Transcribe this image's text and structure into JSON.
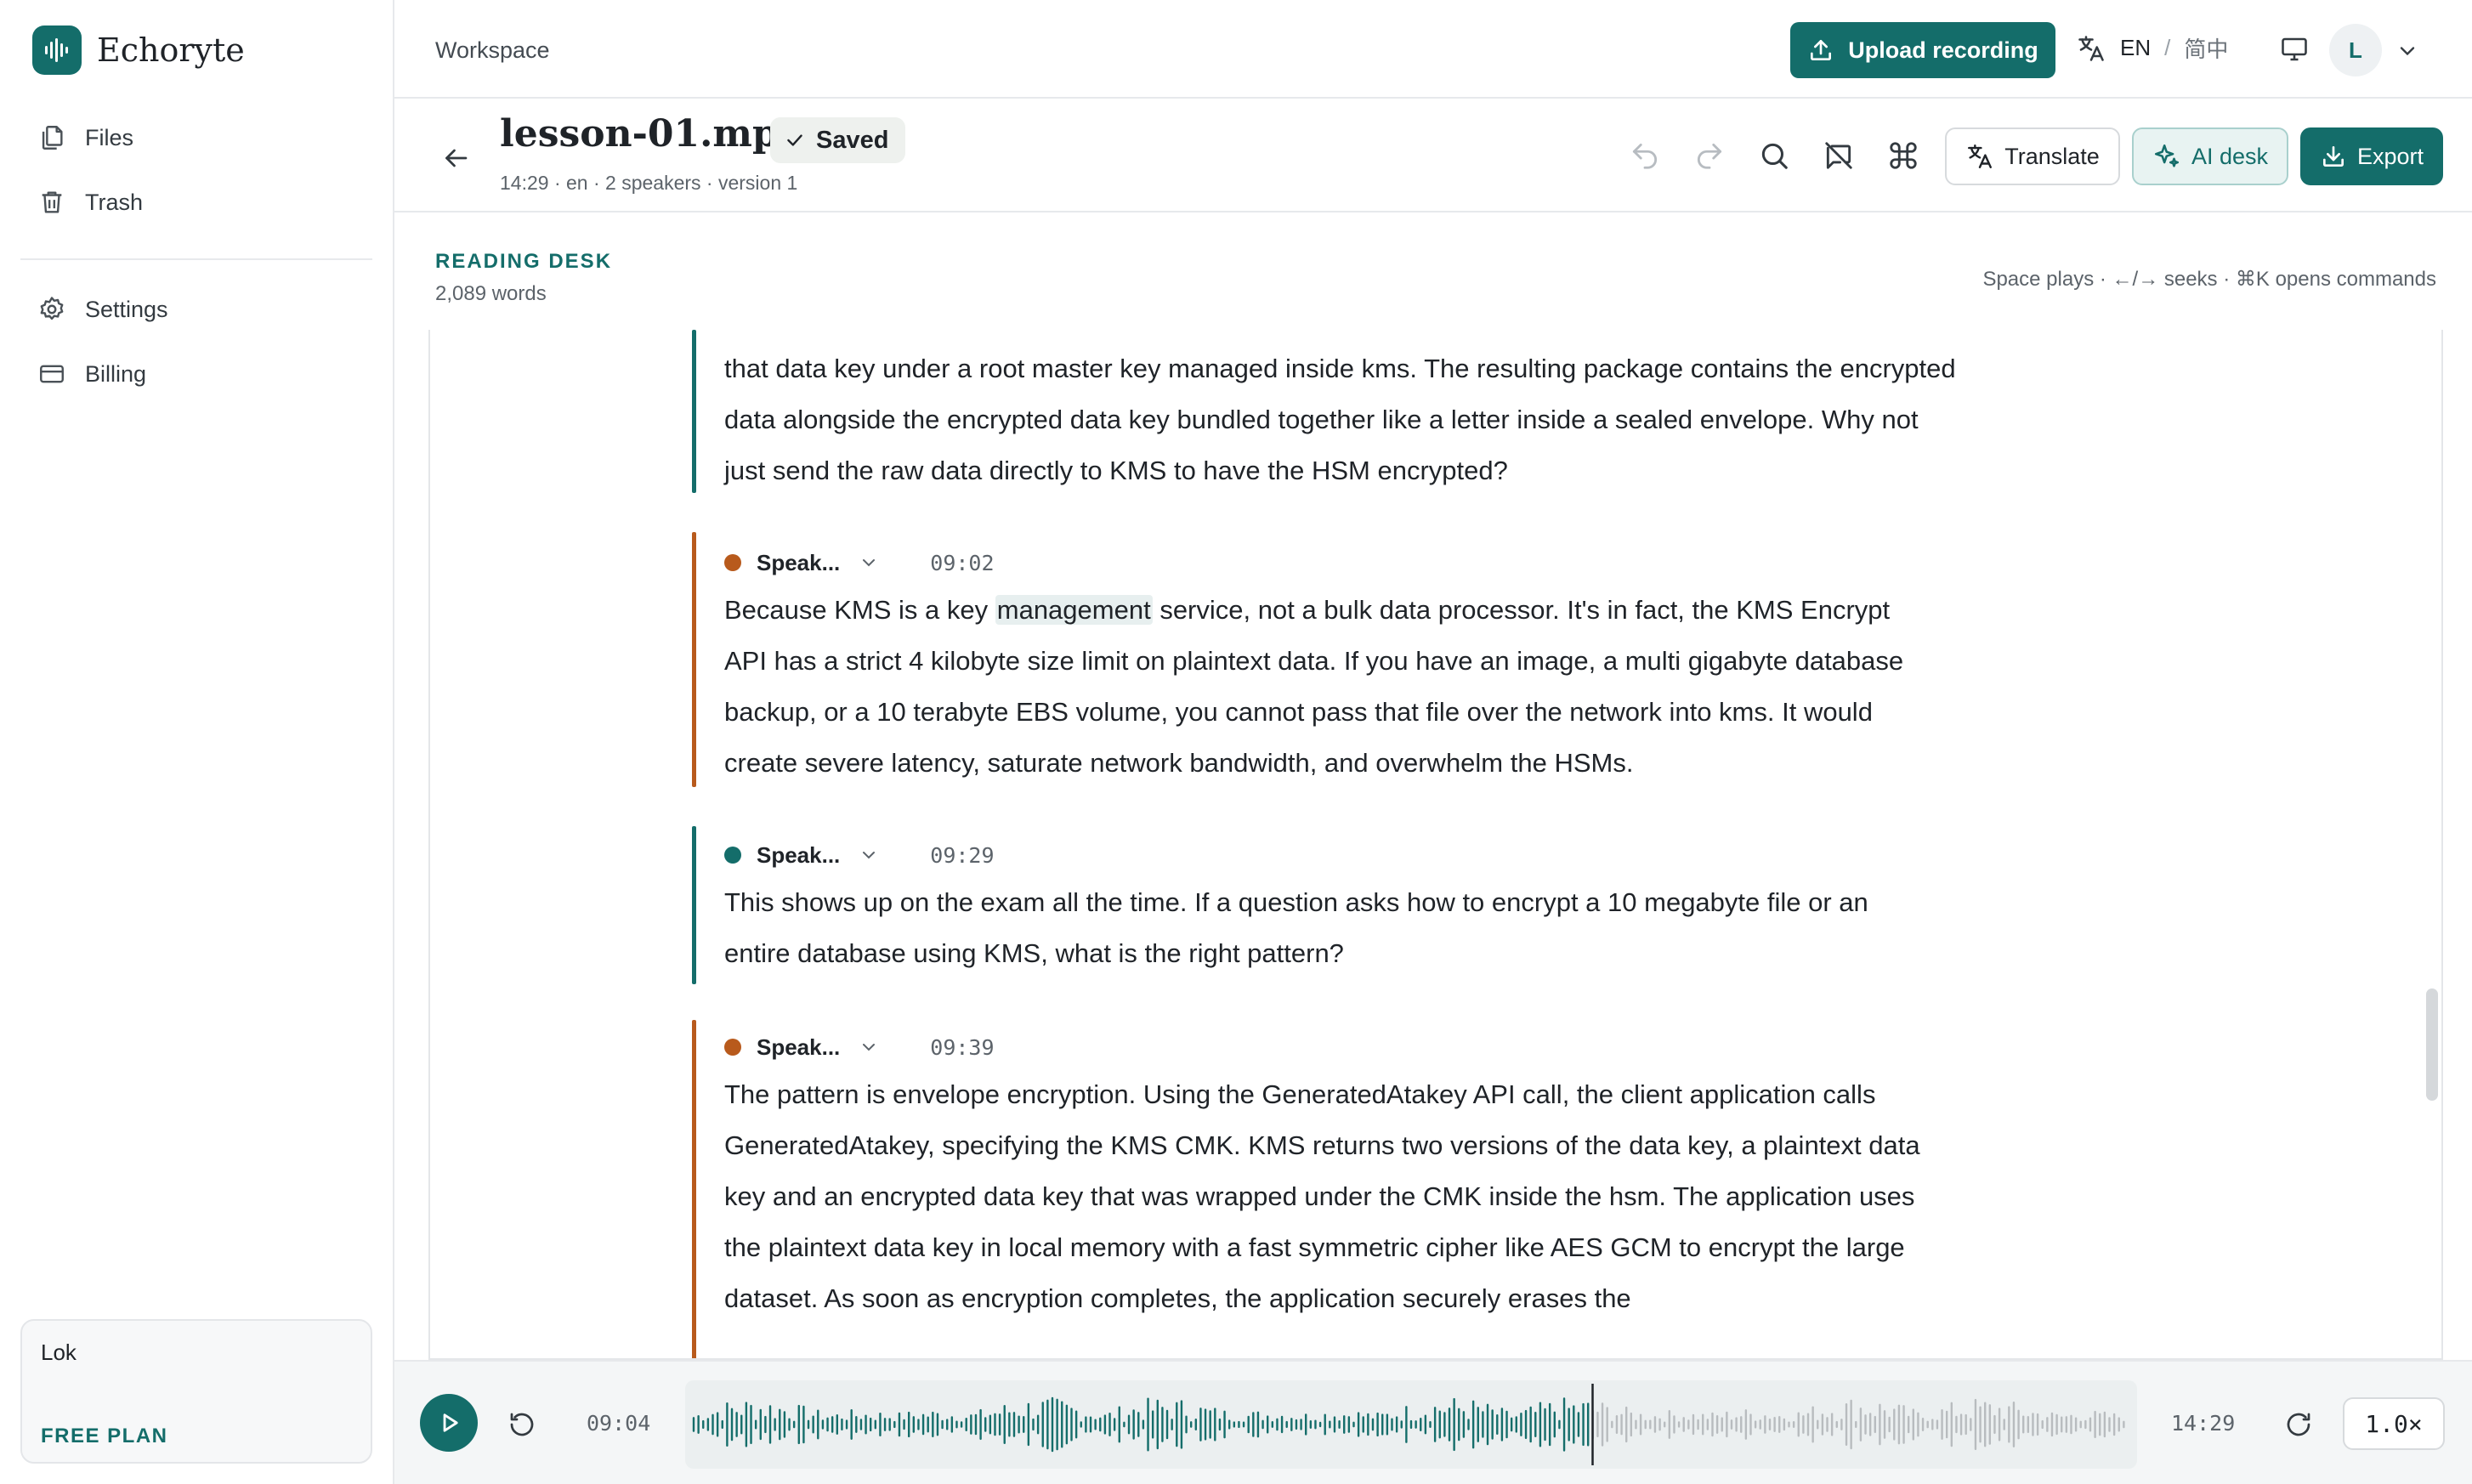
{
  "app": {
    "name": "Echoryte"
  },
  "sidebar": {
    "items": [
      {
        "label": "Files",
        "icon": "files-icon"
      },
      {
        "label": "Trash",
        "icon": "trash-icon"
      },
      {
        "label": "Settings",
        "icon": "gear-icon"
      },
      {
        "label": "Billing",
        "icon": "credit-card-icon"
      }
    ],
    "user": "Lok",
    "plan": "FREE PLAN"
  },
  "topbar": {
    "breadcrumb": "Workspace",
    "upload_label": "Upload recording",
    "lang_current": "EN",
    "lang_separator": "/",
    "lang_alt": "简中",
    "avatar_initial": "L"
  },
  "file": {
    "title": "lesson-01.mp3",
    "status": "Saved",
    "meta": "14:29 · en · 2 speakers · version 1",
    "translate_label": "Translate",
    "ai_label": "AI desk",
    "export_label": "Export"
  },
  "desk": {
    "label": "READING DESK",
    "words": "2,089 words",
    "hint": "Space plays · ←/→ seeks · ⌘K opens commands"
  },
  "segments": [
    {
      "speaker": "",
      "time": "",
      "color": "#146d6a",
      "lines": [
        "that data key under a root master key managed inside kms. The resulting package contains the encrypted",
        "data alongside the encrypted data key bundled together like a letter inside a sealed envelope. Why not",
        "just send the raw data directly to KMS to have the HSM encrypted?"
      ]
    },
    {
      "speaker": "Speak...",
      "time": "09:02",
      "color": "#b85a1c",
      "lines": [
        "Because KMS is a key ",
        "API has a strict 4 kilobyte size limit on plaintext data. If you have an image, a multi gigabyte database",
        "backup, or a 10 terabyte EBS volume, you cannot pass that file over the network into kms. It would",
        "create severe latency, saturate network bandwidth, and overwhelm the HSMs."
      ],
      "highlight_word": "management",
      "line1_rest": " service, not a bulk data processor. It's in fact, the KMS Encrypt"
    },
    {
      "speaker": "Speak...",
      "time": "09:29",
      "color": "#146d6a",
      "lines": [
        "This shows up on the exam all the time. If a question asks how to encrypt a 10 megabyte file or an",
        "entire database using KMS, what is the right pattern?"
      ]
    },
    {
      "speaker": "Speak...",
      "time": "09:39",
      "color": "#b85a1c",
      "lines": [
        "The pattern is envelope encryption. Using the GeneratedAtakey API call, the client application calls",
        "GeneratedAtakey, specifying the KMS CMK. KMS returns two versions of the data key, a plaintext data",
        "key and an encrypted data key that was wrapped under the CMK inside the hsm. The application uses",
        "the plaintext data key in local memory with a fast symmetric cipher like AES GCM to encrypt the large",
        "dataset. As soon as encryption completes, the application securely erases the"
      ]
    }
  ],
  "player": {
    "current_time": "09:04",
    "duration": "14:29",
    "speed": "1.0×",
    "progress": 0.625
  },
  "colors": {
    "accent": "#146d6a",
    "speaker_b": "#b85a1c"
  }
}
